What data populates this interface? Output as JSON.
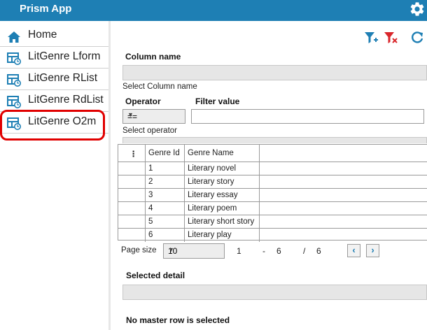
{
  "app": {
    "title": "Prism App"
  },
  "sidebar": {
    "items": [
      {
        "label": "Home"
      },
      {
        "label": "LitGenre Lform"
      },
      {
        "label": "LitGenre RList"
      },
      {
        "label": "LitGenre RdList"
      },
      {
        "label": "LitGenre O2m"
      }
    ]
  },
  "filter": {
    "column_name_label": "Column name",
    "column_hint": "Select Column name",
    "operator_label": "Operator",
    "filter_value_label": "Filter value",
    "operator_value": "==",
    "operator_hint": "Select operator"
  },
  "grid": {
    "menu_glyph": "⋮",
    "columns": [
      "Genre Id",
      "Genre Name"
    ],
    "rows": [
      {
        "id": "1",
        "name": "Literary novel"
      },
      {
        "id": "2",
        "name": "Literary story"
      },
      {
        "id": "3",
        "name": "Literary essay"
      },
      {
        "id": "4",
        "name": "Literary poem"
      },
      {
        "id": "5",
        "name": "Literary short story"
      },
      {
        "id": "6",
        "name": "Literary play"
      }
    ]
  },
  "pager": {
    "page_size_label": "Page size",
    "page_size": "10",
    "from": "1",
    "dash": "-",
    "to": "6",
    "slash": "/",
    "total": "6",
    "prev_glyph": "‹",
    "next_glyph": "›"
  },
  "detail": {
    "title": "Selected detail",
    "empty_message": "No master row is selected"
  },
  "colors": {
    "accent": "#1e7fb4",
    "highlight": "#e10000",
    "filter_red": "#d9262b"
  }
}
